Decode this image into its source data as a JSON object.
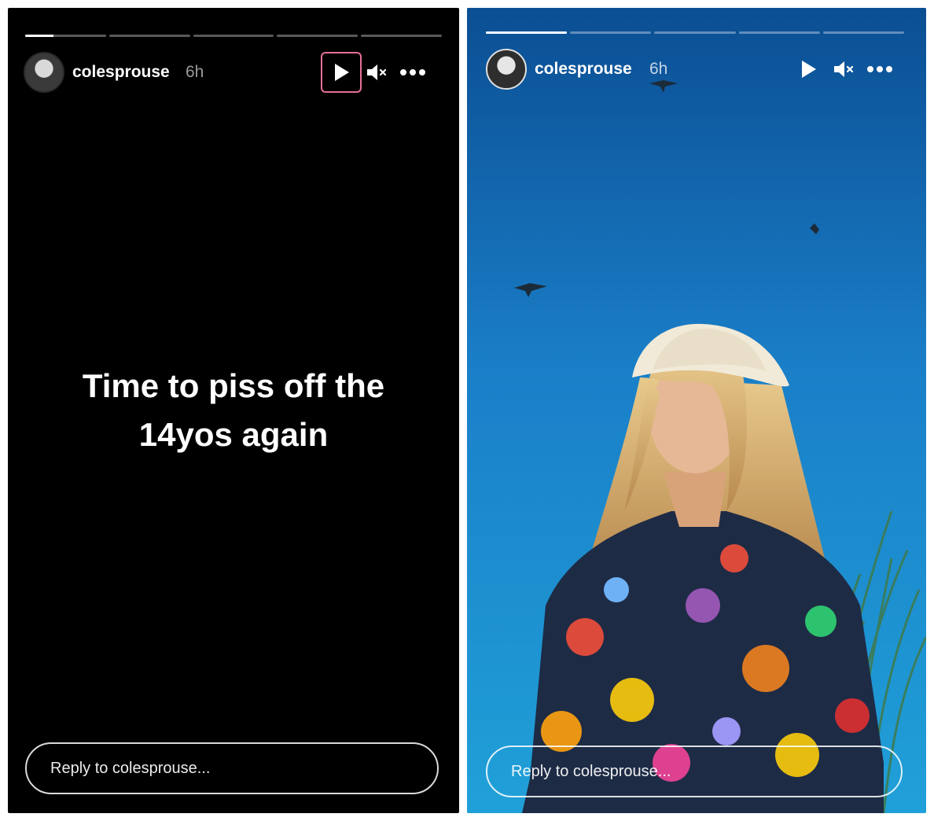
{
  "stories": [
    {
      "username": "colesprouse",
      "time_ago": "6h",
      "progress": [
        0.35,
        0,
        0,
        0,
        0
      ],
      "text_lines": [
        "Time to piss off the",
        "14yos again"
      ],
      "reply_placeholder": "Reply to colesprouse...",
      "controls": {
        "play": "play-icon",
        "mute": "mute-icon",
        "more": "more-icon"
      },
      "play_highlight_color": "#e56f9a"
    },
    {
      "username": "colesprouse",
      "time_ago": "6h",
      "progress": [
        1,
        0,
        0,
        0,
        0
      ],
      "reply_placeholder": "Reply to colesprouse...",
      "controls": {
        "play": "play-icon",
        "mute": "mute-icon",
        "more": "more-icon"
      },
      "sky_color": "#1f8fd2"
    }
  ]
}
